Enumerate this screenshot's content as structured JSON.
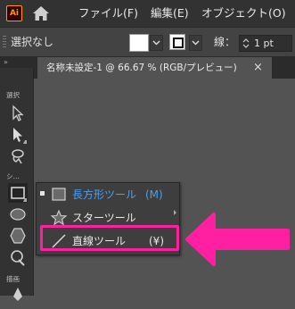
{
  "app": {
    "logo_text": "Ai"
  },
  "menubar": {
    "items": [
      {
        "label": "ファイル(F)"
      },
      {
        "label": "編集(E)"
      },
      {
        "label": "オブジェクト(O)"
      }
    ]
  },
  "controlbar": {
    "selection_label": "選択なし",
    "stroke_label": "線：",
    "stroke_value": "1 pt"
  },
  "toolbar": {
    "top_label": "»",
    "group_select": "選択",
    "group_shape": "シ…",
    "group_draw": "描画"
  },
  "document_tab": {
    "title": "名称未設定-1 @ 66.67 % (RGB/プレビュー)",
    "close": "×"
  },
  "flyout": {
    "items": [
      {
        "label": "長方形ツール",
        "shortcut": "(M)",
        "icon": "rectangle-icon",
        "current": true
      },
      {
        "label": "スターツール",
        "shortcut": "",
        "icon": "star-icon",
        "current": false
      },
      {
        "label": "直線ツール",
        "shortcut": "(¥)",
        "icon": "line-icon",
        "current": false
      }
    ]
  },
  "colors": {
    "highlight": "#ff1fa1",
    "current_tool_text": "#4b9ff0",
    "app_accent": "#ff9a00"
  }
}
